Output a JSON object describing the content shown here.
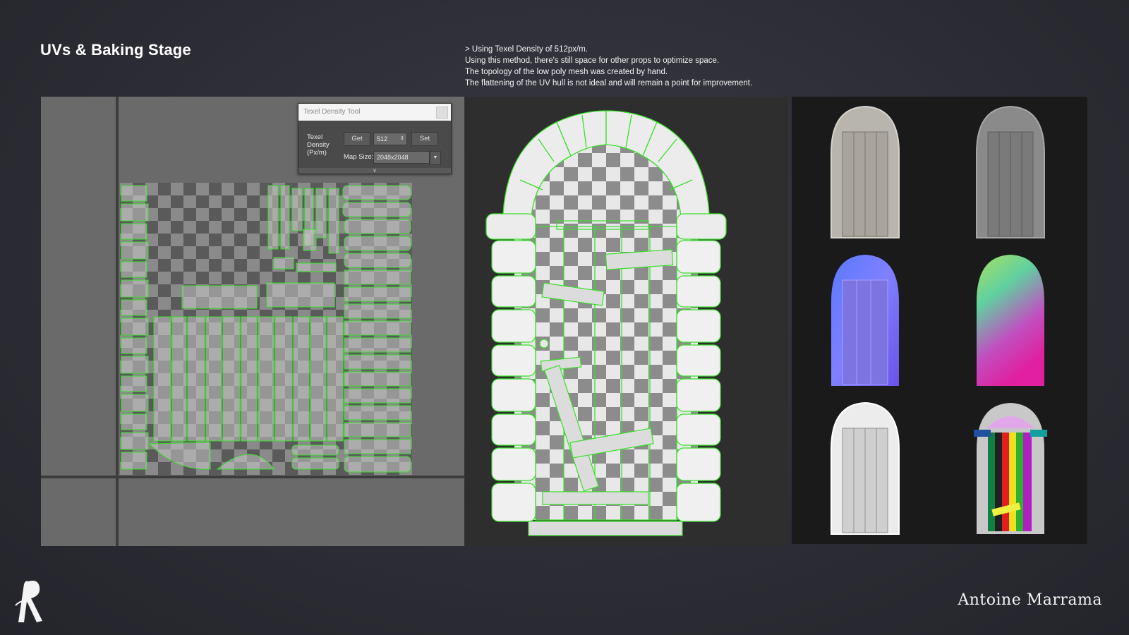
{
  "page": {
    "title": "UVs & Baking Stage",
    "notes": [
      "> Using  Texel Density of 512px/m.",
      "Using this method, there's still space for other props to optimize space.",
      "The topology of the low poly mesh was created by hand.",
      "The flattening of the UV hull is not ideal and will remain a point for improvement."
    ],
    "author": "Antoine Marrama"
  },
  "texel_tool": {
    "title": "Texel Density Tool",
    "density_label": "Texel Density (Px/m)",
    "get_label": "Get",
    "density_value": "512",
    "set_label": "Set",
    "map_size_label": "Map Size:",
    "map_size_value": "2048x2048",
    "expand_glyph": "v"
  },
  "bakes": [
    {
      "name": "material-render",
      "color": "#b8b4ae"
    },
    {
      "name": "ambient-occlusion",
      "color": "#8a8a8a"
    },
    {
      "name": "normal-map",
      "color": "#7a78f0"
    },
    {
      "name": "position-map",
      "color": "#b040c0"
    },
    {
      "name": "curvature-map",
      "color": "#e6e6e6"
    },
    {
      "name": "id-map",
      "color": "#c8c8c8"
    }
  ],
  "colors": {
    "uv_wire": "#39e02a",
    "background": "#2c2c34"
  }
}
